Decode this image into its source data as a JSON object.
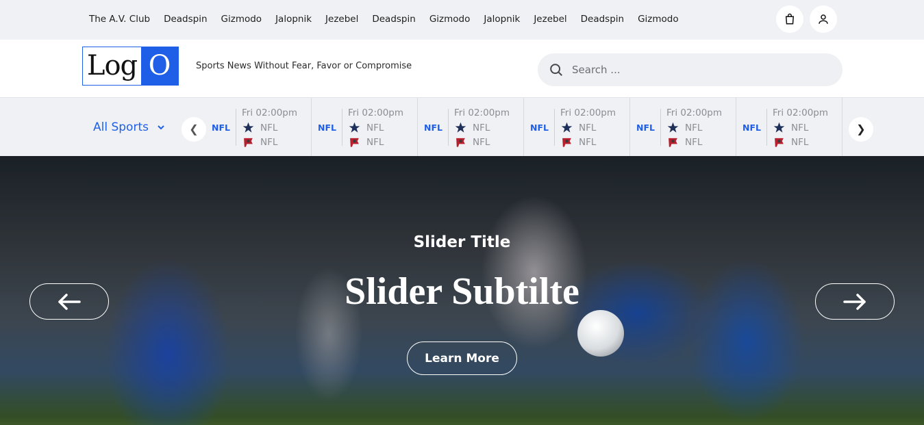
{
  "topbar": {
    "links": [
      "The A.V. Club",
      "Deadspin",
      "Gizmodo",
      "Jalopnik",
      "Jezebel",
      "Deadspin",
      "Gizmodo",
      "Jalopnik",
      "Jezebel",
      "Deadspin",
      "Gizmodo"
    ],
    "icons": [
      "shopping-bag-icon",
      "user-icon"
    ]
  },
  "header": {
    "logo_text_left": "Log",
    "logo_text_right": "O",
    "tagline": "Sports News Without Fear, Favor or Compromise",
    "search_placeholder": "Search ...",
    "accent_color": "#1f5fe8"
  },
  "scores": {
    "filter_label": "All Sports",
    "prev_symbol": "❮",
    "next_symbol": "❯",
    "games": [
      {
        "league": "NFL",
        "time": "Fri 02:00pm",
        "team1": "NFL",
        "team2": "NFL"
      },
      {
        "league": "NFL",
        "time": "Fri 02:00pm",
        "team1": "NFL",
        "team2": "NFL"
      },
      {
        "league": "NFL",
        "time": "Fri 02:00pm",
        "team1": "NFL",
        "team2": "NFL"
      },
      {
        "league": "NFL",
        "time": "Fri 02:00pm",
        "team1": "NFL",
        "team2": "NFL"
      },
      {
        "league": "NFL",
        "time": "Fri 02:00pm",
        "team1": "NFL",
        "team2": "NFL"
      },
      {
        "league": "NFL",
        "time": "Fri 02:00pm",
        "team1": "NFL",
        "team2": "NFL"
      }
    ]
  },
  "hero": {
    "title": "Slider Title",
    "subtitle": "Slider Subtilte",
    "cta_label": "Learn More"
  }
}
